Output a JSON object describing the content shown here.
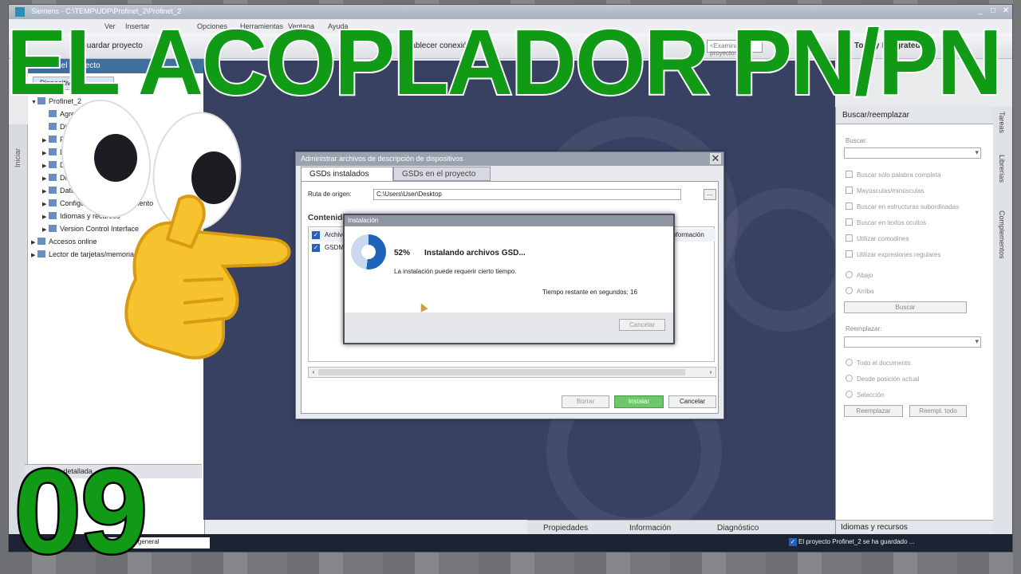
{
  "window": {
    "title": "Siemens  -  C:\\TEMP\\UDP\\Profinet_2\\Profinet_2",
    "controls": [
      "_",
      "□",
      "✕"
    ]
  },
  "menubar": {
    "items": [
      "Ver",
      "Insertar",
      "Opciones",
      "Herramientas",
      "Ventana",
      "Ayuda"
    ]
  },
  "toolbar": {
    "save_project": "Guardar proyecto",
    "connect_online": "Establecer conexión online",
    "search_placeholder": "<Examinar proyecto>",
    "totally_integrated": "Totally Integrated"
  },
  "left_panel": {
    "header": "Árbol del proyecto",
    "tab": "Dispositivos",
    "tree": [
      {
        "label": "Profinet_2",
        "arrow": "▼",
        "indent": 0
      },
      {
        "label": "Agregar dispositivo",
        "arrow": "",
        "indent": 1
      },
      {
        "label": "Dispositivos y redes",
        "arrow": "",
        "indent": 1
      },
      {
        "label": "PLC_1",
        "arrow": "▶",
        "indent": 1
      },
      {
        "label": "Dispositivos no agrupados",
        "arrow": "▶",
        "indent": 1
      },
      {
        "label": "Datos comunes",
        "arrow": "▶",
        "indent": 1
      },
      {
        "label": "Dispositivos sin agrupar",
        "arrow": "▶",
        "indent": 1
      },
      {
        "label": "Datos comunes",
        "arrow": "▶",
        "indent": 1
      },
      {
        "label": "Configuración del documento",
        "arrow": "▶",
        "indent": 1
      },
      {
        "label": "Idiomas y recursos",
        "arrow": "▶",
        "indent": 1
      },
      {
        "label": "Version Control Interface",
        "arrow": "▶",
        "indent": 1
      },
      {
        "label": "Accesos online",
        "arrow": "▶",
        "indent": 0
      },
      {
        "label": "Lector de tarjetas/memoria USB",
        "arrow": "▶",
        "indent": 0
      }
    ],
    "vista": "Vista detallada",
    "side_tab": "Iniciar"
  },
  "right_panel": {
    "title": "Buscar/reemplazar",
    "search_label": "Buscar:",
    "options": [
      "Buscar sólo palabra completa",
      "Mayúsculas/minúsculas",
      "Buscar en estructuras subordinadas",
      "Buscar en textos ocultos",
      "Utilizar comodines",
      "Utilizar expresiones regulares"
    ],
    "direction": [
      "Abajo",
      "Arriba"
    ],
    "search_button": "Buscar",
    "replace_label": "Reemplazar:",
    "scope": [
      "Todo el documento",
      "Desde posición actual",
      "Selección"
    ],
    "replace_button": "Reemplazar",
    "replace_all_button": "Reempl. todo",
    "bottom": "Idiomas y recursos",
    "side_tabs": [
      "Tareas",
      "Librerías",
      "Complementos"
    ]
  },
  "bottom_tabs": {
    "properties": "Propiedades",
    "info": "Información",
    "diagnostics": "Diagnóstico"
  },
  "status": {
    "portal": "Vista general",
    "message": "El proyecto Profinet_2 se ha guardado ..."
  },
  "gsd_dialog": {
    "title": "Administrar archivos de descripción de dispositivos",
    "tab_installed": "GSDs instalados",
    "tab_project": "GSDs en el proyecto",
    "path_label": "Ruta de origen:",
    "path_value": "C:\\Users\\User\\Desktop",
    "browse": "...",
    "content_label": "Contenido de la ruta importada",
    "rows": [
      "Archivo",
      "GSDML-V2.31-Siemens-PNPN..."
    ],
    "col_info": "Información",
    "delete": "Borrar",
    "install": "Instalar",
    "cancel": "Cancelar"
  },
  "install_dialog": {
    "title": "Instalación",
    "percent": "52%",
    "percent_value": 52,
    "message": "Instalando archivos GSD...",
    "sub": "La instalación puede requerir cierto tiempo.",
    "time": "Tiempo restante en segundos: 16",
    "cancel": "Cancelar"
  },
  "overlay": {
    "title": "EL ACOPLADOR PN/PN",
    "number": "09"
  },
  "colors": {
    "overlay_green": "#109a16",
    "workspace": "#394163",
    "install_green": "#6cc86a"
  }
}
